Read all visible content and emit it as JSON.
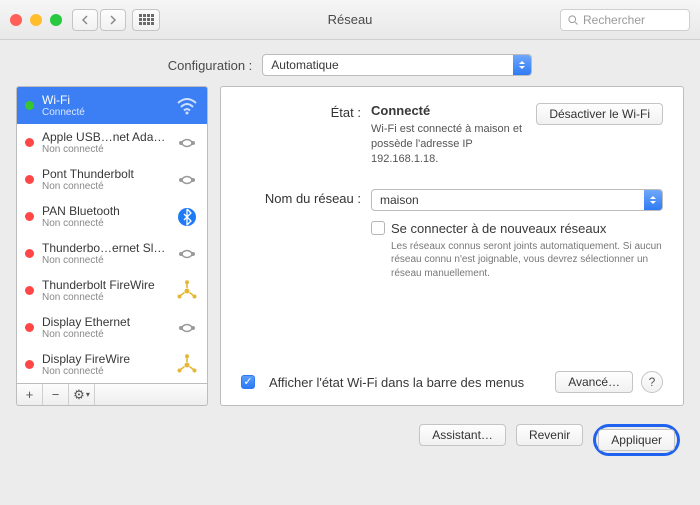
{
  "window": {
    "title": "Réseau",
    "search_placeholder": "Rechercher"
  },
  "config": {
    "label": "Configuration :",
    "value": "Automatique"
  },
  "sidebar": {
    "items": [
      {
        "name": "Wi-Fi",
        "status": "Connecté",
        "dot": "green",
        "icon": "wifi"
      },
      {
        "name": "Apple USB…net Adapter",
        "status": "Non connecté",
        "dot": "red",
        "icon": "ethernet"
      },
      {
        "name": "Pont Thunderbolt",
        "status": "Non connecté",
        "dot": "red",
        "icon": "ethernet"
      },
      {
        "name": "PAN Bluetooth",
        "status": "Non connecté",
        "dot": "red",
        "icon": "bluetooth"
      },
      {
        "name": "Thunderbo…ernet Slot 2",
        "status": "Non connecté",
        "dot": "red",
        "icon": "ethernet"
      },
      {
        "name": "Thunderbolt FireWire",
        "status": "Non connecté",
        "dot": "red",
        "icon": "firewire"
      },
      {
        "name": "Display Ethernet",
        "status": "Non connecté",
        "dot": "red",
        "icon": "ethernet"
      },
      {
        "name": "Display FireWire",
        "status": "Non connecté",
        "dot": "red",
        "icon": "firewire"
      }
    ],
    "toolbar": {
      "add": "+",
      "remove": "−",
      "gear": "⚙"
    }
  },
  "detail": {
    "status_label": "État :",
    "status_value": "Connecté",
    "wifi_off_button": "Désactiver le Wi-Fi",
    "status_desc": "Wi-Fi est connecté à maison et possède l'adresse IP 192.168.1.18.",
    "network_label": "Nom du réseau :",
    "network_value": "maison",
    "join_new_label": "Se connecter à de nouveaux réseaux",
    "join_new_hint": "Les réseaux connus seront joints automatiquement. Si aucun réseau connu n'est joignable, vous devrez sélectionner un réseau manuellement.",
    "show_menu_label": "Afficher l'état Wi-Fi dans la barre des menus",
    "advanced_button": "Avancé…",
    "help": "?"
  },
  "footer": {
    "assistant": "Assistant…",
    "revert": "Revenir",
    "apply": "Appliquer"
  }
}
